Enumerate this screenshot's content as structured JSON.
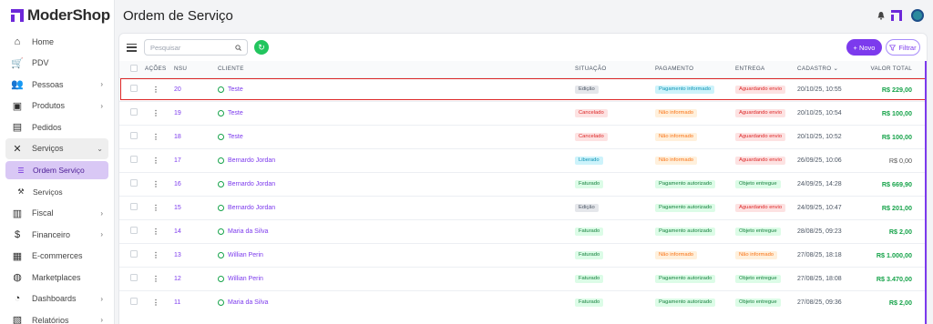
{
  "app": {
    "logo_text": "ModerShop",
    "brand_color": "#7c3aed"
  },
  "header": {
    "title": "Ordem de Serviço"
  },
  "sidebar": {
    "items": [
      {
        "label": "Home",
        "icon": "home-icon",
        "chevron": false
      },
      {
        "label": "PDV",
        "icon": "cart-icon",
        "chevron": false
      },
      {
        "label": "Pessoas",
        "icon": "users-icon",
        "chevron": true
      },
      {
        "label": "Produtos",
        "icon": "box-icon",
        "chevron": true
      },
      {
        "label": "Pedidos",
        "icon": "orders-icon",
        "chevron": false
      },
      {
        "label": "Serviços",
        "icon": "tools-icon",
        "chevron": true,
        "expanded": true
      },
      {
        "label": "Ordem Serviço",
        "icon": "list-icon",
        "sub": true,
        "active": true
      },
      {
        "label": "Serviços",
        "icon": "wrench-icon",
        "sub": true
      },
      {
        "label": "Fiscal",
        "icon": "fiscal-icon",
        "chevron": true
      },
      {
        "label": "Financeiro",
        "icon": "dollar-icon",
        "chevron": true
      },
      {
        "label": "E-commerces",
        "icon": "ecommerce-icon",
        "chevron": false
      },
      {
        "label": "Marketplaces",
        "icon": "globe-icon",
        "chevron": false
      },
      {
        "label": "Dashboards",
        "icon": "pie-icon",
        "chevron": true
      },
      {
        "label": "Relatórios",
        "icon": "report-icon",
        "chevron": true
      }
    ]
  },
  "toolbar": {
    "search_placeholder": "Pesquisar",
    "new_label": "+ Novo",
    "filter_label": "Filtrar"
  },
  "table": {
    "headers": {
      "acoes": "AÇÕES",
      "nsu": "NSU",
      "cliente": "CLIENTE",
      "situacao": "SITUAÇÃO",
      "pagamento": "PAGAMENTO",
      "entrega": "ENTREGA",
      "cadastro": "CADASTRO",
      "valor": "VALOR TOTAL"
    },
    "rows": [
      {
        "nsu": "20",
        "cliente": "Teste",
        "situacao": "Edição",
        "pagamento": "Pagamento informado",
        "entrega": "Aguardando envio",
        "cadastro": "20/10/25, 10:55",
        "valor": "R$ 229,00"
      },
      {
        "nsu": "19",
        "cliente": "Teste",
        "situacao": "Cancelado",
        "pagamento": "Não informado",
        "entrega": "Aguardando envio",
        "cadastro": "20/10/25, 10:54",
        "valor": "R$ 100,00"
      },
      {
        "nsu": "18",
        "cliente": "Teste",
        "situacao": "Cancelado",
        "pagamento": "Não informado",
        "entrega": "Aguardando envio",
        "cadastro": "20/10/25, 10:52",
        "valor": "R$ 100,00"
      },
      {
        "nsu": "17",
        "cliente": "Bernardo Jordan",
        "situacao": "Liberado",
        "pagamento": "Não informado",
        "entrega": "Aguardando envio",
        "cadastro": "26/09/25, 10:06",
        "valor": "R$ 0,00"
      },
      {
        "nsu": "16",
        "cliente": "Bernardo Jordan",
        "situacao": "Faturado",
        "pagamento": "Pagamento autorizado",
        "entrega": "Objeto entregue",
        "cadastro": "24/09/25, 14:28",
        "valor": "R$ 669,90"
      },
      {
        "nsu": "15",
        "cliente": "Bernardo Jordan",
        "situacao": "Edição",
        "pagamento": "Pagamento autorizado",
        "entrega": "Aguardando envio",
        "cadastro": "24/09/25, 10:47",
        "valor": "R$ 201,00"
      },
      {
        "nsu": "14",
        "cliente": "Maria da Silva",
        "situacao": "Faturado",
        "pagamento": "Pagamento autorizado",
        "entrega": "Objeto entregue",
        "cadastro": "28/08/25, 09:23",
        "valor": "R$ 2,00"
      },
      {
        "nsu": "13",
        "cliente": "Willian Perin",
        "situacao": "Faturado",
        "pagamento": "Não informado",
        "entrega": "Não informado",
        "cadastro": "27/08/25, 18:18",
        "valor": "R$ 1.000,00"
      },
      {
        "nsu": "12",
        "cliente": "Willian Perin",
        "situacao": "Faturado",
        "pagamento": "Pagamento autorizado",
        "entrega": "Objeto entregue",
        "cadastro": "27/08/25, 18:08",
        "valor": "R$ 3.470,00"
      },
      {
        "nsu": "11",
        "cliente": "Maria da Silva",
        "situacao": "Faturado",
        "pagamento": "Pagamento autorizado",
        "entrega": "Objeto entregue",
        "cadastro": "27/08/25, 09:36",
        "valor": "R$ 2,00"
      }
    ]
  }
}
